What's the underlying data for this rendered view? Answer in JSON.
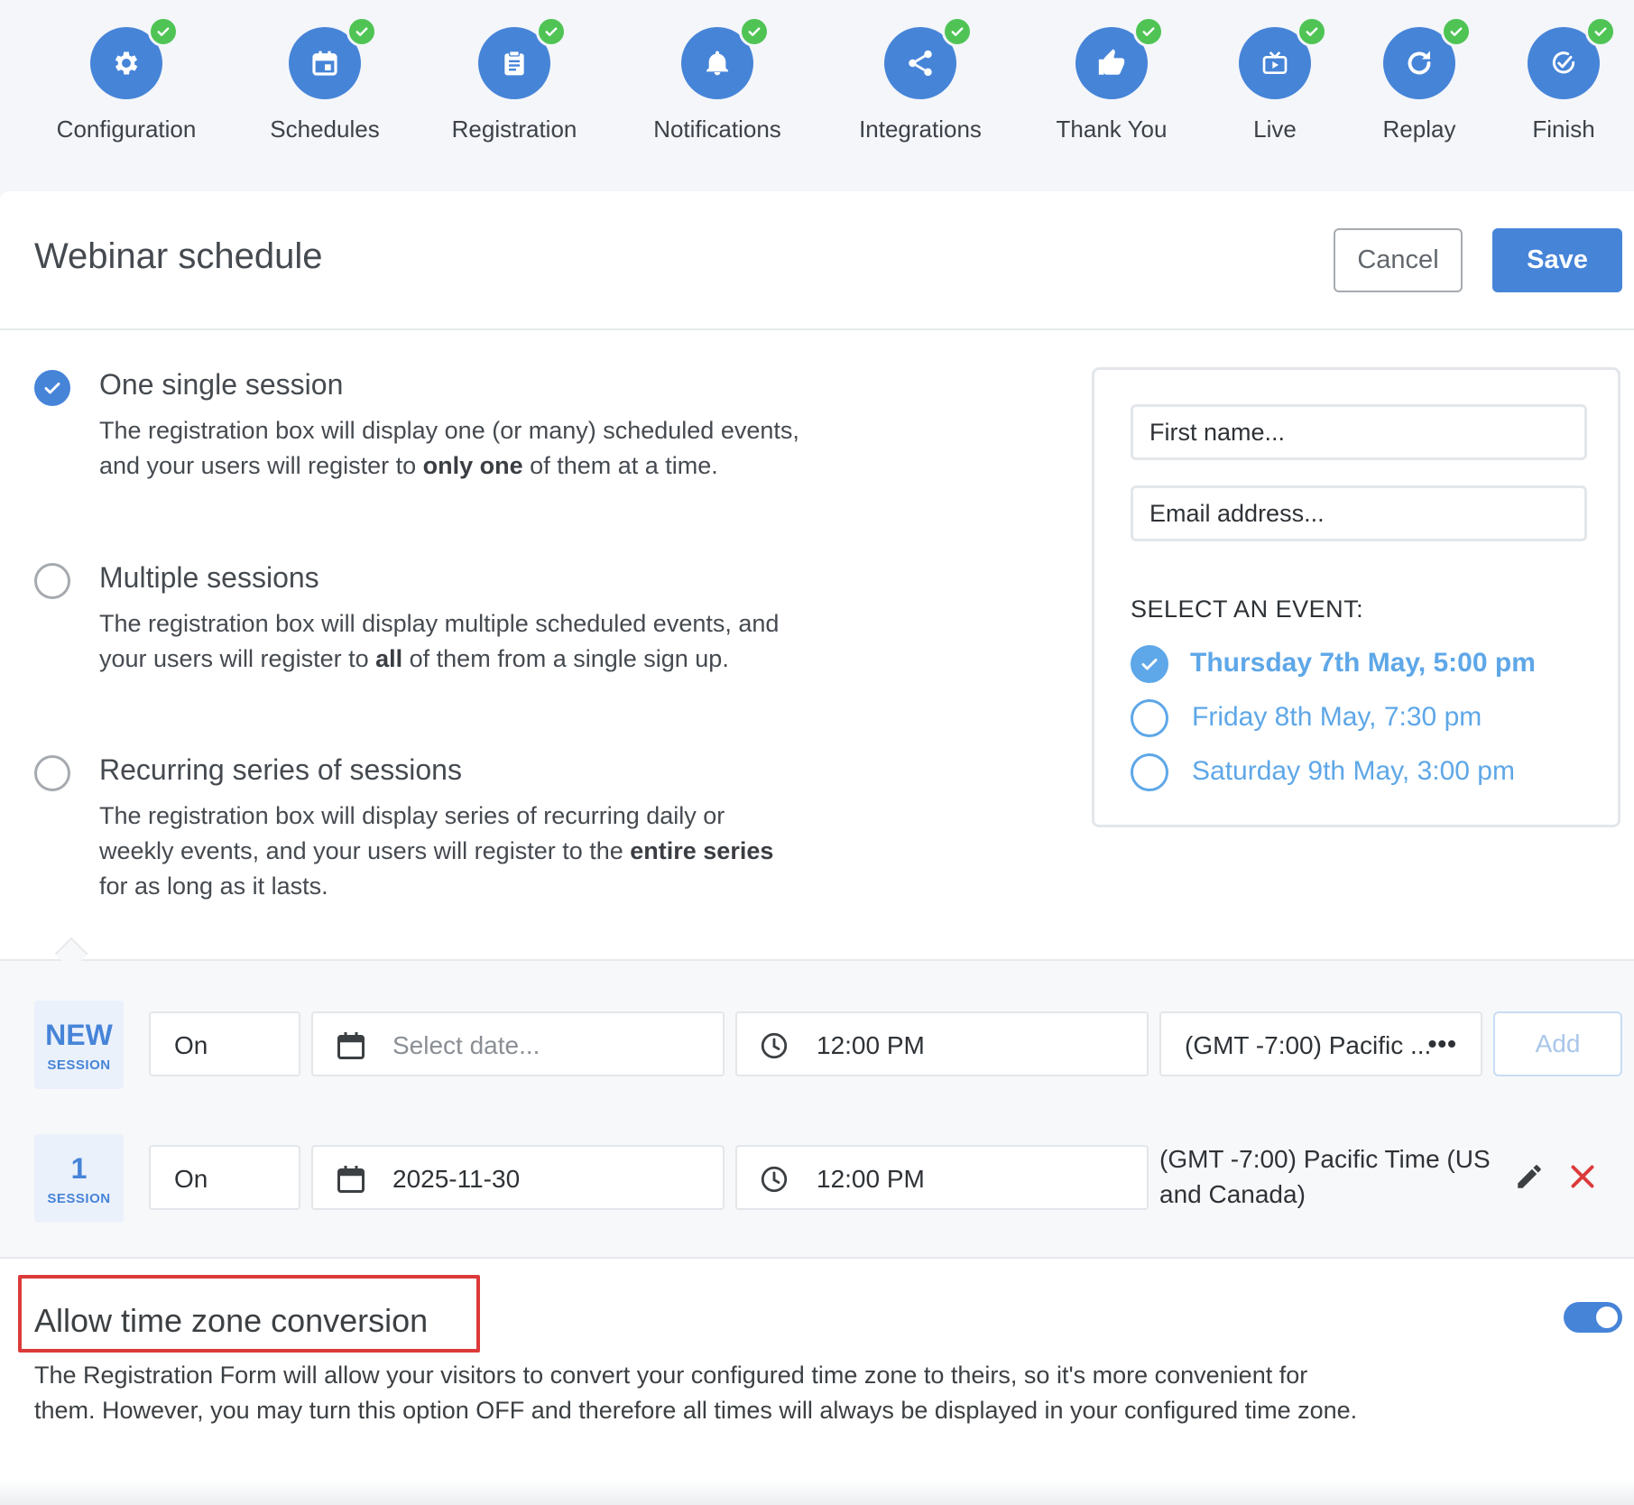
{
  "stepper": [
    {
      "label": "Configuration",
      "icon": "gear-icon",
      "completed": true
    },
    {
      "label": "Schedules",
      "icon": "calendar-icon",
      "completed": true
    },
    {
      "label": "Registration",
      "icon": "clipboard-icon",
      "completed": true
    },
    {
      "label": "Notifications",
      "icon": "bell-icon",
      "completed": true
    },
    {
      "label": "Integrations",
      "icon": "share-icon",
      "completed": true
    },
    {
      "label": "Thank You",
      "icon": "thumbs-up-icon",
      "completed": true
    },
    {
      "label": "Live",
      "icon": "live-tv-icon",
      "completed": true
    },
    {
      "label": "Replay",
      "icon": "replay-icon",
      "completed": true
    },
    {
      "label": "Finish",
      "icon": "check-circle-icon",
      "completed": true
    }
  ],
  "header": {
    "title": "Webinar schedule",
    "cancel_label": "Cancel",
    "save_label": "Save"
  },
  "options": [
    {
      "title": "One single session",
      "selected": true,
      "desc_before": "The registration box will display one (or many) scheduled events, and your users will register to ",
      "desc_bold": "only one",
      "desc_after": " of them at a time."
    },
    {
      "title": "Multiple sessions",
      "selected": false,
      "desc_before": "The registration box will display multiple scheduled events, and your users will register to ",
      "desc_bold": "all",
      "desc_after": " of them from a single sign up."
    },
    {
      "title": "Recurring series of sessions",
      "selected": false,
      "desc_before": "The registration box will display series of recurring daily or weekly events, and your users will register to the ",
      "desc_bold": "entire series",
      "desc_after": " for as long as it lasts."
    }
  ],
  "preview": {
    "first_name_placeholder": "First name...",
    "email_placeholder": "Email address...",
    "select_label": "SELECT AN EVENT:",
    "events": [
      {
        "label": "Thursday 7th May, 5:00 pm",
        "selected": true
      },
      {
        "label": "Friday 8th May, 7:30 pm",
        "selected": false
      },
      {
        "label": "Saturday 9th May, 3:00 pm",
        "selected": false
      }
    ]
  },
  "new_session": {
    "badge_main": "NEW",
    "badge_sub": "SESSION",
    "on_label": "On",
    "date_placeholder": "Select date...",
    "time": "12:00 PM",
    "timezone": "(GMT -7:00) Pacific ...",
    "more": "•••",
    "add_label": "Add"
  },
  "session_1": {
    "badge_main": "1",
    "badge_sub": "SESSION",
    "on_label": "On",
    "date": "2025-11-30",
    "time": "12:00 PM",
    "timezone": "(GMT -7:00) Pacific Time (US and Canada)"
  },
  "tz_conversion": {
    "title": "Allow time zone conversion",
    "description": "The Registration Form will allow your visitors to convert your configured time zone to theirs, so it's more convenient for them. However, you may turn this option OFF and therefore all times will always be displayed in your configured time zone.",
    "enabled": true
  },
  "colors": {
    "primary": "#4684d8",
    "check_green": "#4fc455",
    "preview_blue": "#5ea7e8",
    "delete_red": "#dc3a3a"
  }
}
